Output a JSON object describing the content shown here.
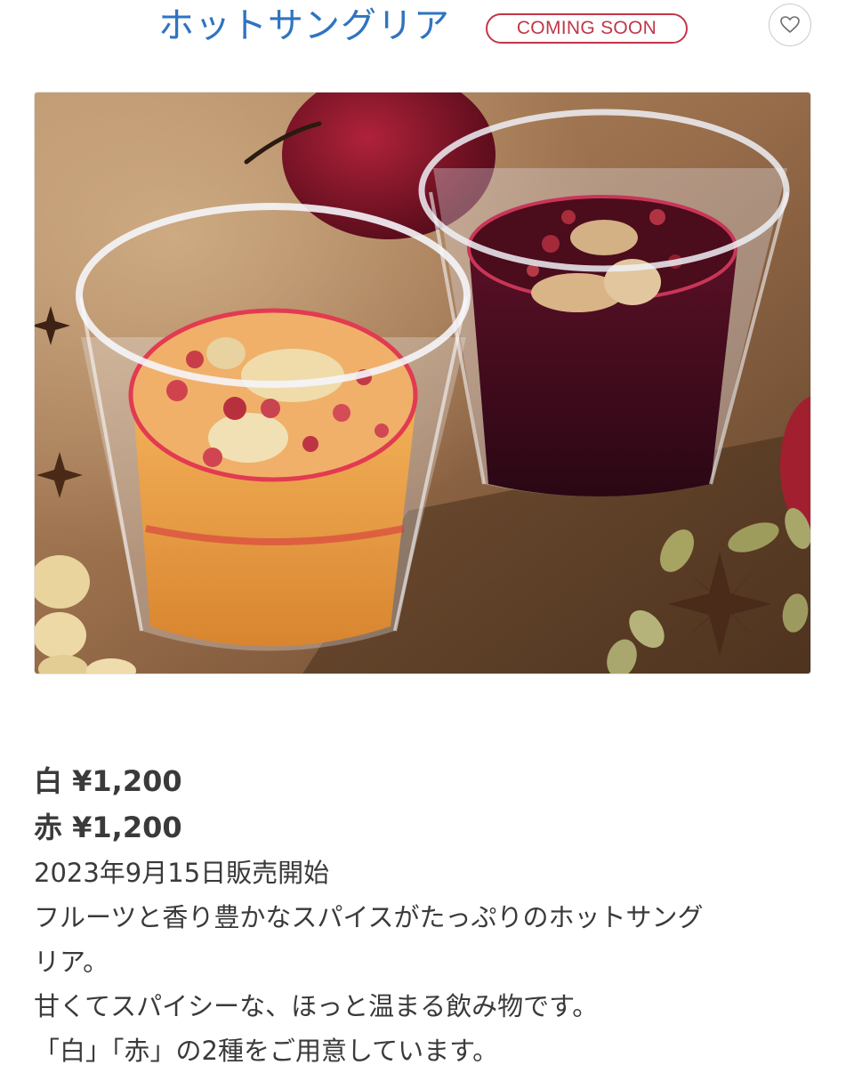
{
  "header": {
    "title": "ホットサングリア",
    "badge": "COMING SOON",
    "favorite_icon": "heart-icon"
  },
  "product_image": {
    "description_icon": "product-photo"
  },
  "prices": [
    {
      "label": "白 ¥1,200"
    },
    {
      "label": "赤 ¥1,200"
    }
  ],
  "release_date": "2023年9月15日販売開始",
  "description": {
    "line1": "フルーツと香り豊かなスパイスがたっぷりのホットサング",
    "line2": "リア。",
    "line3": "甘くてスパイシーな、ほっと温まる飲み物です。",
    "line4": "「白」「赤」の2種をご用意しています。"
  },
  "colors": {
    "title": "#2f74c0",
    "badge": "#c0374a",
    "text": "#3a3a3a"
  }
}
